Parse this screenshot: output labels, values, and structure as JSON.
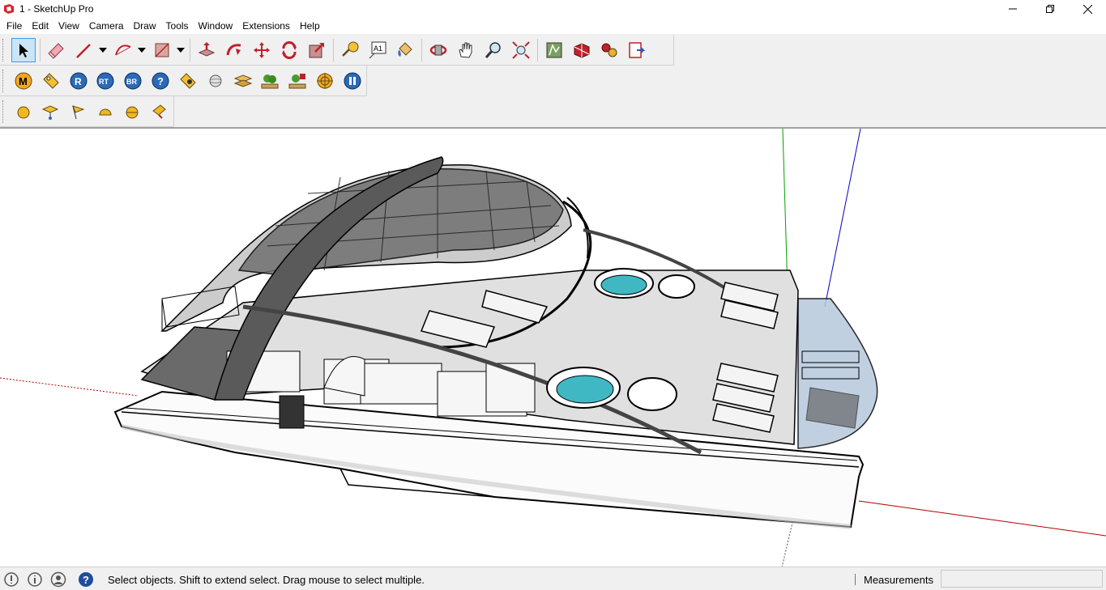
{
  "window": {
    "title": "1 - SketchUp Pro",
    "minimize_icon": "minimize-icon",
    "restore_icon": "restore-icon",
    "close_icon": "close-icon"
  },
  "menu": [
    "File",
    "Edit",
    "View",
    "Camera",
    "Draw",
    "Tools",
    "Window",
    "Extensions",
    "Help"
  ],
  "toolbar_icons": {
    "row1": [
      "select-icon",
      "eraser-icon",
      "line-icon",
      "arc-icon",
      "rectangle-icon",
      "push-pull-icon",
      "follow-me-icon",
      "move-icon",
      "rotate-icon",
      "scale-icon",
      "tape-measure-icon",
      "text-icon",
      "paint-bucket-icon",
      "orbit-icon",
      "pan-icon",
      "zoom-icon",
      "zoom-extents-icon",
      "3d-warehouse-icon",
      "extension-warehouse-icon",
      "components-icon",
      "send-to-layout-icon"
    ],
    "row2": [
      "m-icon",
      "tag-icon",
      "r-icon",
      "rt-icon",
      "br-icon",
      "help-icon",
      "lens-icon",
      "sphere-icon",
      "stripes-icon",
      "tree-icon",
      "tree-edit-icon",
      "target-icon",
      "pause-icon"
    ],
    "row3": [
      "ball-icon",
      "plane-icon",
      "flag-icon",
      "dome-icon",
      "half-sphere-icon",
      "folder-icon"
    ]
  },
  "status": {
    "message": "Select objects. Shift to extend select. Drag mouse to select multiple.",
    "measurements_label": "Measurements",
    "measurements_value": ""
  },
  "colors": {
    "accent": "#3c9ee8",
    "axis_red": "#b00000",
    "axis_green": "#00a000",
    "axis_blue": "#0000c8",
    "water": "#3fb8c4"
  }
}
